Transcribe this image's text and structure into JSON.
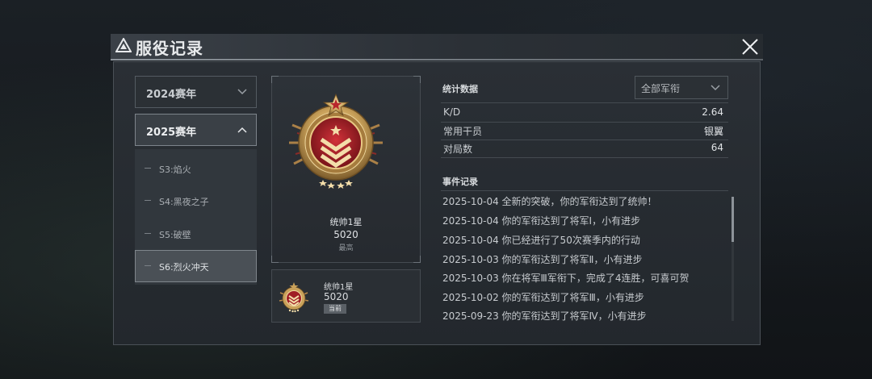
{
  "header": {
    "title": "服役记录"
  },
  "seasons": [
    {
      "label": "2024赛年",
      "expanded": false
    },
    {
      "label": "2025赛年",
      "expanded": true
    }
  ],
  "sub_seasons": [
    {
      "label": "S3:焰火"
    },
    {
      "label": "S4:黑夜之子"
    },
    {
      "label": "S5:破壁"
    },
    {
      "label": "S6:烈火冲天",
      "selected": true
    }
  ],
  "best_rank": {
    "name": "统帅1星",
    "score": "5020",
    "note": "最高"
  },
  "current_rank": {
    "name": "统帅1星",
    "score": "5020",
    "badge": "当前"
  },
  "stats": {
    "title": "统计数据",
    "filter": "全部军衔",
    "rows": [
      {
        "key": "K/D",
        "value": "2.64"
      },
      {
        "key": "常用干员",
        "value": "银翼"
      },
      {
        "key": "对局数",
        "value": "64"
      }
    ]
  },
  "events": {
    "title": "事件记录",
    "items": [
      "2025-10-04 全新的突破，你的军衔达到了统帅！",
      "2025-10-04 你的军衔达到了将军Ⅰ，小有进步",
      "2025-10-04 你已经进行了50次赛季内的行动",
      "2025-10-03 你的军衔达到了将军Ⅱ，小有进步",
      "2025-10-03 你在将军Ⅲ军衔下，完成了4连胜，可喜可贺",
      "2025-10-02 你的军衔达到了将军Ⅲ，小有进步",
      "2025-09-23 你的军衔达到了将军Ⅳ，小有进步"
    ]
  },
  "colors": {
    "medal_gold": "#c9a15a",
    "medal_red": "#9e1d24",
    "panel": "#262b30"
  }
}
